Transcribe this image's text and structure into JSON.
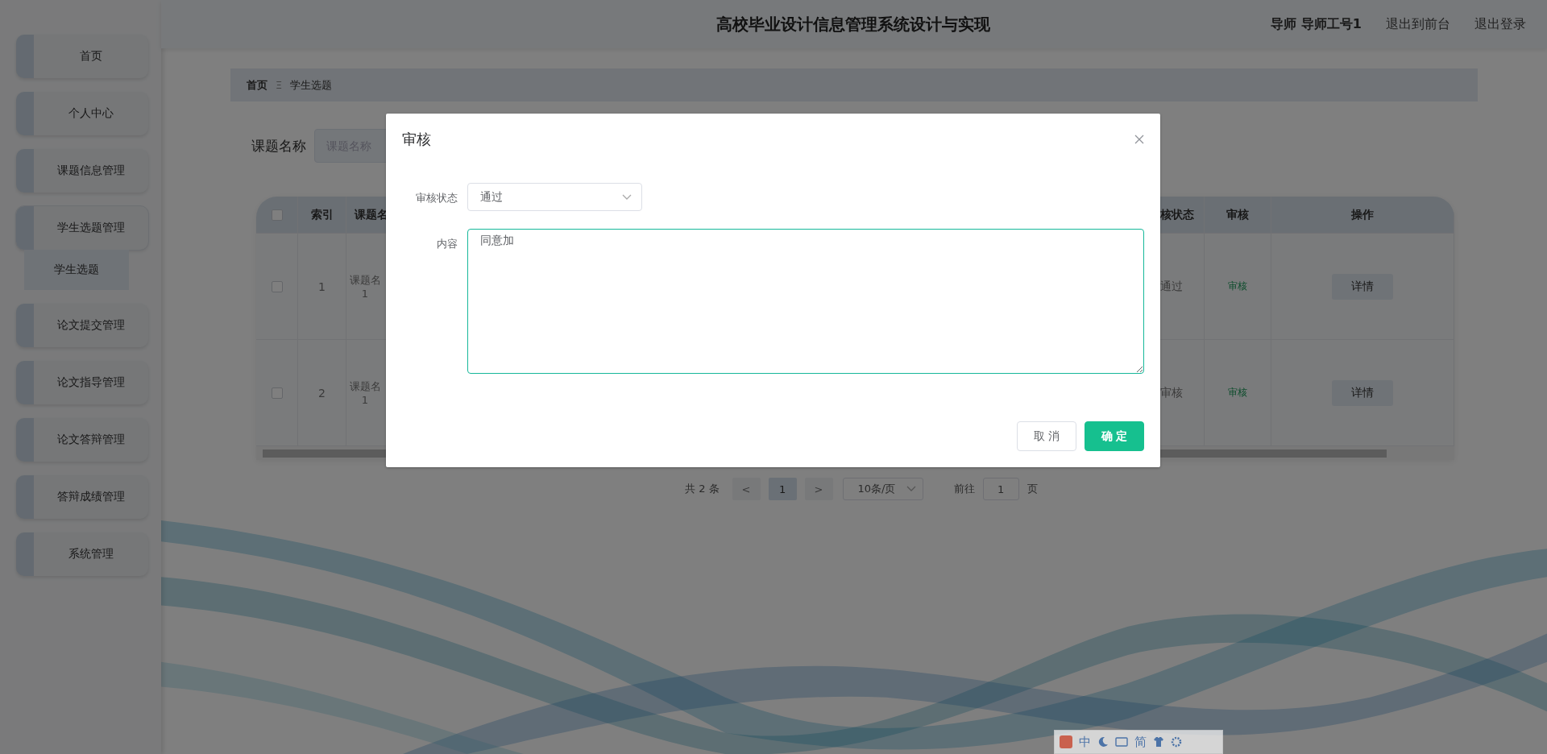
{
  "header": {
    "title": "高校毕业设计信息管理系统设计与实现",
    "user": "导师 导师工号1",
    "links": [
      "退出到前台",
      "退出登录"
    ]
  },
  "sidebar": {
    "items": [
      {
        "label": "首页",
        "expanded": false
      },
      {
        "label": "个人中心",
        "expanded": false
      },
      {
        "label": "课题信息管理",
        "expanded": false
      },
      {
        "label": "学生选题管理",
        "expanded": true,
        "children": [
          {
            "label": "学生选题",
            "selected": true
          }
        ]
      },
      {
        "label": "论文提交管理",
        "expanded": false
      },
      {
        "label": "论文指导管理",
        "expanded": false
      },
      {
        "label": "论文答辩管理",
        "expanded": false
      },
      {
        "label": "答辩成绩管理",
        "expanded": false
      },
      {
        "label": "系统管理",
        "expanded": false
      }
    ]
  },
  "breadcrumb": {
    "items": [
      "首页",
      "学生选题"
    ],
    "separator": "Ξ"
  },
  "search": {
    "label": "课题名称",
    "placeholder": "课题名称"
  },
  "table": {
    "select_all_checked": false,
    "columns": [
      "索引",
      "课题名",
      "核状态",
      "审核",
      "操作"
    ],
    "rows": [
      {
        "checked": false,
        "index": "1",
        "title": "课题名",
        "title_line2": "1",
        "status": "通过",
        "review": "审核",
        "action": "详情"
      },
      {
        "checked": false,
        "index": "2",
        "title": "课题名",
        "title_line2": "1",
        "status": "审核",
        "review": "审核",
        "action": "详情"
      }
    ]
  },
  "pagination": {
    "total": "共 2 条",
    "prev": "<",
    "pages": [
      {
        "label": "1",
        "selected": true
      }
    ],
    "next": ">",
    "page_size": "10条/页",
    "goto_label": "前往",
    "goto_value": "1",
    "goto_suffix": "页"
  },
  "dialog": {
    "title": "审核",
    "fields": [
      {
        "kind": "select",
        "label": "审核状态",
        "value": "通过"
      },
      {
        "kind": "textarea",
        "label": "内容",
        "value": "同意加",
        "focused": true
      }
    ],
    "buttons": [
      {
        "label": "取 消",
        "kind": "default"
      },
      {
        "label": "确 定",
        "kind": "primary"
      }
    ]
  },
  "ime_bar": {
    "mode": "中",
    "charset": "简"
  }
}
